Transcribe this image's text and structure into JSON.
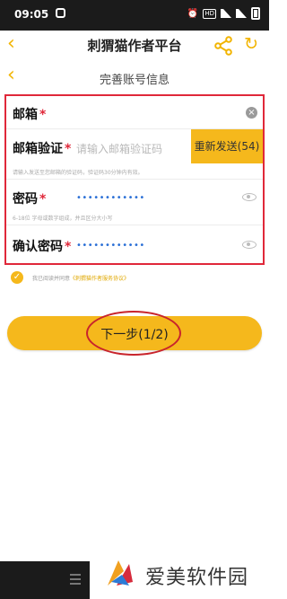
{
  "status_bar": {
    "time": "09:05",
    "hd_label": "HD"
  },
  "top_bar": {
    "title": "刺猬猫作者平台",
    "back_glyph": "‹",
    "refresh_glyph": "↻"
  },
  "sub_bar": {
    "title": "完善账号信息",
    "back_glyph": "‹"
  },
  "form": {
    "required_mark": "*",
    "email": {
      "label": "邮箱",
      "clear_glyph": "×"
    },
    "email_code": {
      "label": "邮箱验证",
      "placeholder": "请输入邮箱验证码",
      "resend_label": "重新发送(54)",
      "hint": "请输入发送至您邮箱的验证码，验证码30分钟内有效。"
    },
    "password": {
      "label": "密码",
      "value": "••••••••••••",
      "hint": "6-18位 字母或数字组成，并且区分大小写"
    },
    "confirm_password": {
      "label": "确认密码",
      "value": "••••••••••••"
    }
  },
  "agreement": {
    "check_glyph": "✓",
    "text": "我已阅读并同意",
    "link_text": "《刺猬猫作者服务协议》"
  },
  "next_button": {
    "label": "下一步(1/2)"
  },
  "watermark": {
    "text": "爱美软件园"
  },
  "colors": {
    "accent": "#f5b81c",
    "highlight": "#e0283a",
    "link": "#2a6fd6"
  }
}
